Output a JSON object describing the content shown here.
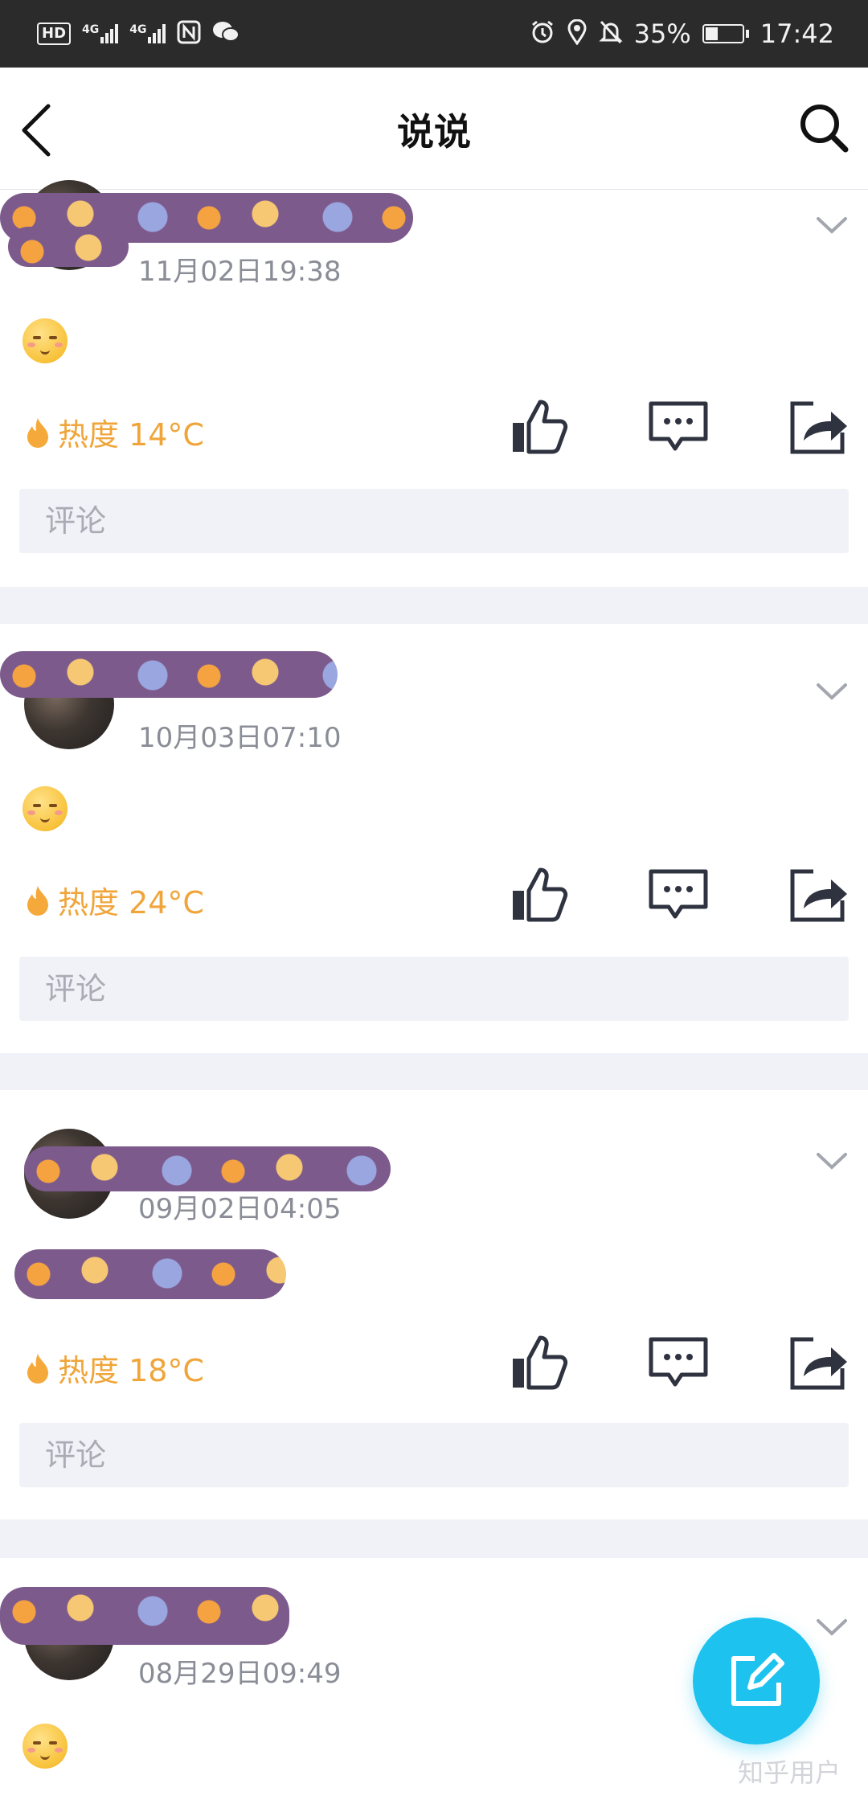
{
  "status_bar": {
    "hd_label": "HD",
    "network_1": "4G",
    "network_2": "4G",
    "battery_text": "35%",
    "battery_level": 0.35,
    "time": "17:42"
  },
  "header": {
    "title": "说说"
  },
  "posts": [
    {
      "time": "11月02日19:38",
      "heat": "热度 14°C",
      "comment_placeholder": "评论"
    },
    {
      "time": "10月03日07:10",
      "heat": "热度 24°C",
      "comment_placeholder": "评论"
    },
    {
      "time": "09月02日04:05",
      "heat": "热度 18°C",
      "comment_placeholder": "评论"
    },
    {
      "time": "08月29日09:49"
    }
  ],
  "watermark": "知乎用户",
  "colors": {
    "accent": "#1ec2ef",
    "heat": "#f0a53a",
    "icon": "#2f3340",
    "page_bg": "#f0f2f7"
  }
}
